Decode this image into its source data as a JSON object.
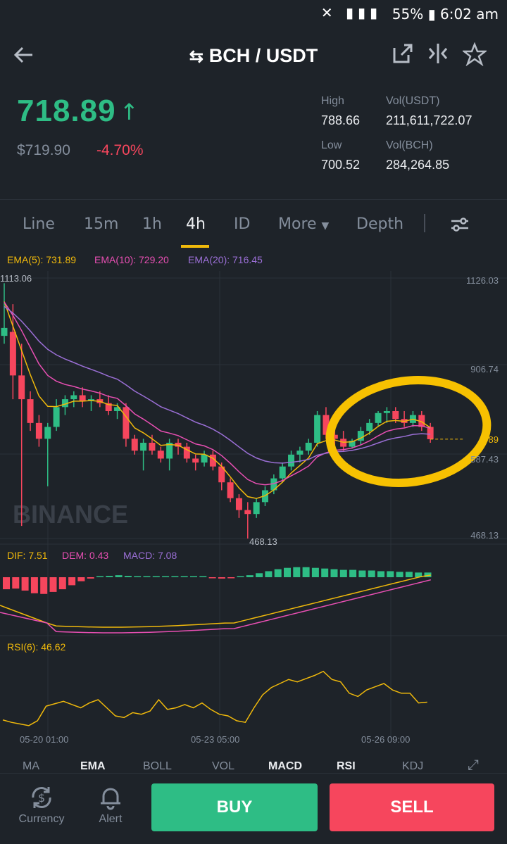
{
  "status_bar": {
    "battery": "55%",
    "time": "6:02 am"
  },
  "header": {
    "title": "BCH / USDT"
  },
  "ticker": {
    "last_price": "718.89",
    "usd_price": "$719.90",
    "change": "-4.70%",
    "high_label": "High",
    "high_value": "788.66",
    "low_label": "Low",
    "low_value": "700.52",
    "vol_usdt_label": "Vol(USDT)",
    "vol_usdt_value": "211,611,722.07",
    "vol_bch_label": "Vol(BCH)",
    "vol_bch_value": "284,264.85"
  },
  "tabs": {
    "line": "Line",
    "m15": "15m",
    "h1": "1h",
    "h4": "4h",
    "d1": "ID",
    "more": "More",
    "depth": "Depth"
  },
  "legend": {
    "ema5": "EMA(5): 731.89",
    "ema10": "EMA(10): 729.20",
    "ema20": "EMA(20): 716.45"
  },
  "macd_legend": {
    "dif": "DIF: 7.51",
    "dem": "DEM: 0.43",
    "macd": "MACD: 7.08"
  },
  "rsi_legend": {
    "rsi": "RSI(6): 46.62"
  },
  "axis": {
    "y_top": "1126.03",
    "y_mid": "906.74",
    "y_cur": "587.43",
    "y_bot": "468.13",
    "last_tag": "89",
    "max_marker": "1113.06",
    "min_marker": "468.13",
    "x1": "05-20 01:00",
    "x2": "05-23 05:00",
    "x3": "05-26 09:00"
  },
  "watermark": "BINANCE",
  "indicator_tabs": {
    "ma": "MA",
    "ema": "EMA",
    "boll": "BOLL",
    "vol": "VOL",
    "macd": "MACD",
    "rsi": "RSI",
    "kdj": "KDJ"
  },
  "bottom": {
    "currency": "Currency",
    "alert": "Alert",
    "buy": "BUY",
    "sell": "SELL"
  },
  "colors": {
    "up": "#2ebd85",
    "down": "#f6465d",
    "accent": "#f0b90b",
    "ema5": "#f0b90b",
    "ema10": "#e84fb3",
    "ema20": "#9b6fd6"
  },
  "chart_data": {
    "type": "candlestick",
    "candles": [
      {
        "o": 980,
        "h": 1113,
        "l": 960,
        "c": 1000
      },
      {
        "o": 990,
        "h": 1060,
        "l": 820,
        "c": 880
      },
      {
        "o": 880,
        "h": 960,
        "l": 500,
        "c": 820
      },
      {
        "o": 820,
        "h": 840,
        "l": 740,
        "c": 760
      },
      {
        "o": 760,
        "h": 780,
        "l": 700,
        "c": 720
      },
      {
        "o": 720,
        "h": 760,
        "l": 600,
        "c": 750
      },
      {
        "o": 750,
        "h": 820,
        "l": 740,
        "c": 800
      },
      {
        "o": 800,
        "h": 830,
        "l": 780,
        "c": 820
      },
      {
        "o": 820,
        "h": 840,
        "l": 800,
        "c": 830
      },
      {
        "o": 830,
        "h": 850,
        "l": 800,
        "c": 815
      },
      {
        "o": 815,
        "h": 830,
        "l": 790,
        "c": 820
      },
      {
        "o": 820,
        "h": 840,
        "l": 800,
        "c": 810
      },
      {
        "o": 810,
        "h": 830,
        "l": 780,
        "c": 790
      },
      {
        "o": 790,
        "h": 810,
        "l": 770,
        "c": 800
      },
      {
        "o": 800,
        "h": 810,
        "l": 700,
        "c": 720
      },
      {
        "o": 720,
        "h": 730,
        "l": 680,
        "c": 690
      },
      {
        "o": 690,
        "h": 720,
        "l": 640,
        "c": 710
      },
      {
        "o": 710,
        "h": 730,
        "l": 680,
        "c": 690
      },
      {
        "o": 690,
        "h": 700,
        "l": 660,
        "c": 670
      },
      {
        "o": 670,
        "h": 720,
        "l": 640,
        "c": 710
      },
      {
        "o": 710,
        "h": 720,
        "l": 680,
        "c": 700
      },
      {
        "o": 700,
        "h": 710,
        "l": 660,
        "c": 670
      },
      {
        "o": 670,
        "h": 680,
        "l": 640,
        "c": 660
      },
      {
        "o": 660,
        "h": 690,
        "l": 650,
        "c": 680
      },
      {
        "o": 680,
        "h": 690,
        "l": 640,
        "c": 650
      },
      {
        "o": 650,
        "h": 660,
        "l": 590,
        "c": 610
      },
      {
        "o": 610,
        "h": 620,
        "l": 560,
        "c": 570
      },
      {
        "o": 570,
        "h": 580,
        "l": 520,
        "c": 540
      },
      {
        "o": 540,
        "h": 560,
        "l": 468,
        "c": 530
      },
      {
        "o": 530,
        "h": 570,
        "l": 520,
        "c": 560
      },
      {
        "o": 560,
        "h": 600,
        "l": 550,
        "c": 590
      },
      {
        "o": 590,
        "h": 630,
        "l": 580,
        "c": 620
      },
      {
        "o": 620,
        "h": 660,
        "l": 610,
        "c": 650
      },
      {
        "o": 650,
        "h": 690,
        "l": 640,
        "c": 680
      },
      {
        "o": 680,
        "h": 700,
        "l": 660,
        "c": 690
      },
      {
        "o": 690,
        "h": 720,
        "l": 680,
        "c": 710
      },
      {
        "o": 710,
        "h": 790,
        "l": 700,
        "c": 780
      },
      {
        "o": 780,
        "h": 800,
        "l": 720,
        "c": 730
      },
      {
        "o": 730,
        "h": 760,
        "l": 700,
        "c": 720
      },
      {
        "o": 720,
        "h": 740,
        "l": 690,
        "c": 700
      },
      {
        "o": 700,
        "h": 720,
        "l": 695,
        "c": 715
      },
      {
        "o": 715,
        "h": 750,
        "l": 705,
        "c": 740
      },
      {
        "o": 740,
        "h": 770,
        "l": 730,
        "c": 760
      },
      {
        "o": 760,
        "h": 790,
        "l": 750,
        "c": 785
      },
      {
        "o": 785,
        "h": 800,
        "l": 760,
        "c": 790
      },
      {
        "o": 790,
        "h": 800,
        "l": 760,
        "c": 770
      },
      {
        "o": 770,
        "h": 790,
        "l": 750,
        "c": 760
      },
      {
        "o": 760,
        "h": 790,
        "l": 750,
        "c": 780
      },
      {
        "o": 780,
        "h": 790,
        "l": 740,
        "c": 750
      },
      {
        "o": 750,
        "h": 760,
        "l": 710,
        "c": 719
      }
    ],
    "ylim": [
      468.13,
      1126.03
    ],
    "x_ticks": [
      "05-20 01:00",
      "05-23 05:00",
      "05-26 09:00"
    ],
    "y_ticks": [
      "1126.03",
      "906.74",
      "587.43",
      "468.13"
    ],
    "rsi": [
      15,
      12,
      10,
      8,
      14,
      32,
      35,
      38,
      34,
      30,
      36,
      40,
      30,
      20,
      18,
      24,
      22,
      26,
      40,
      28,
      30,
      34,
      30,
      36,
      28,
      22,
      20,
      14,
      12,
      30,
      46,
      55,
      60,
      65,
      62,
      66,
      70,
      75,
      65,
      62,
      48,
      44,
      52,
      56,
      60,
      52,
      48,
      48,
      36,
      37
    ],
    "macd": [
      -18,
      -17,
      -20,
      -24,
      -25,
      -22,
      -18,
      -12,
      -6,
      -2,
      0,
      2,
      3,
      2,
      1,
      0,
      1,
      0,
      0,
      0,
      0,
      0,
      -1,
      -2,
      -1,
      0,
      3,
      6,
      9,
      12,
      14,
      15,
      15,
      14,
      13,
      12,
      11,
      11,
      10,
      10,
      9,
      9,
      8,
      8,
      7,
      7
    ],
    "grid": true
  }
}
